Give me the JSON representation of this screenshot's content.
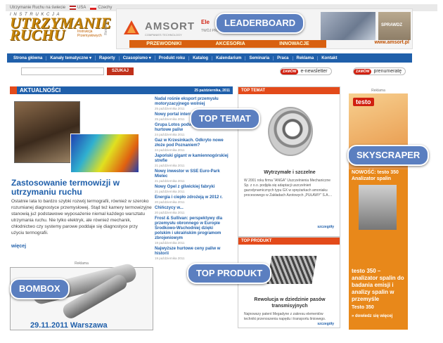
{
  "topbar": {
    "site": "Utrzymanie Ruchu na świecie",
    "usa": "USA",
    "czech": "Czechy"
  },
  "logo": {
    "top": "I N S T R U K C J A",
    "main1": "UTRZYMANIE",
    "main2": "RUCHU",
    "sub": "Instrukcja Przemysłowych",
    "side": "Reklama"
  },
  "leaderboard": {
    "brand": "AMSORT",
    "brand_sub": "COMPANIES TECHNOLOGY",
    "tagline": "Ele",
    "tagline2": "TWÓJ PRZEWODNIK",
    "strip": [
      "PRZEWODNIKI",
      "AKCESORIA",
      "INNOWACJE"
    ],
    "url": "www.amsort.pl",
    "product": "SPRAWDZ"
  },
  "nav": [
    "Strona główna",
    "Kanały tematyczne ▾",
    "Raporty",
    "Czasopismo ▾",
    "Produkt roku",
    "Katalog",
    "Kalendarium",
    "Seminaria",
    "Praca",
    "Reklama",
    "Kontakt"
  ],
  "search": {
    "button": "SZUKAJ"
  },
  "pills": {
    "badge": "ZAMÓW",
    "newsletter": "e-newsletter",
    "prenumerata": "prenumeratę"
  },
  "aktualnosci": {
    "title": "AKTUALNOŚCI",
    "date": "25 października, 2011"
  },
  "main_article": {
    "title": "Zastosowanie termowizji w utrzymaniu ruchu",
    "body": "Ostatnie lata to bardzo szybki rozwój termografii, również w szeroko rozumianej diagnostyce przemysłowej. Stąd też kamery termowizyjne stanowią już podstawowe wyposażenie niemal każdego warsztatu utrzymania ruchu. Nie tylko elektryk, ale również mechanik, chłodnictwo czy systemy parowe poddaje się diagnostyce przy użyciu termografii.",
    "more": "więcej"
  },
  "news": [
    {
      "t": "Nadal rośnie eksport przemysłu motoryzacyjnego wolniej",
      "d": "25 października 2011"
    },
    {
      "t": "Nowy portal internetowy Solid Edge",
      "d": "25 października 2011"
    },
    {
      "t": "Grupa Lotos podwyższyła ceny hurtowe paliw",
      "d": "24 października 2011"
    },
    {
      "t": "Gaz w Krzesinkach. Odkryto nowe złoże pod Poznaniem?",
      "d": "24 października 2011"
    },
    {
      "t": "Japoński gigant w kamiennogórskiej strefie",
      "d": "21 października 2011"
    },
    {
      "t": "Nowy inwestor w SSE Euro-Park Mielec",
      "d": "21 października 2011"
    },
    {
      "t": "Nowy Opel z gliwickiej fabryki",
      "d": "21 października 2011"
    },
    {
      "t": "Energia i ciepło zdrożeją w 2012 r.",
      "d": "20 października 2011"
    },
    {
      "t": "Chińczycy w...",
      "d": "20 października 2011"
    },
    {
      "t": "Frost & Sullivan: perspektywy dla przemysłu obronnego w Europie Środkowo-Wschodniej dzięki polskim i ukraińskim programom zbrojeniowym",
      "d": "19 października 2011"
    },
    {
      "t": "Najwyższe hurtowe ceny paliw w historii",
      "d": "19 października 2011"
    }
  ],
  "top_temat": {
    "header": "TOP TEMAT",
    "title": "Wytrzymałe i szczelne",
    "body": "W 2001 roku firma \"ANGA\" Uszczelnienia Mechaniczne Sp. z o.o. podjęła się adaptacji uszczelnień gazodynamicznych typu GX w sprężarkach amoniaku procesowego w Zakładach Azotowych „PUŁAWY” S.A....",
    "more": "szczegóły"
  },
  "top_produkt": {
    "header": "TOP PRODUKT",
    "title": "Rewolucja w dziedzinie pasów transmisyjnych",
    "body": "Najnowszy patent Megadyne z zakresu elementów techniki przenoszenia napędu i transportu liniowego.",
    "more": "szczegóły"
  },
  "skyscraper": {
    "reklama": "Reklama",
    "logo": "testo",
    "headline": "NOWOŚĆ: testo 350 Analizator spalin",
    "headline2": "testo 350 – analizator spalin do badania emisji i analizy spalin w przemyśle",
    "headline3": "Testo 350",
    "cta": "» dowiedz się więcej"
  },
  "bombox": {
    "reklama": "Reklama",
    "date": "29.11.2011 Warszawa"
  },
  "callouts": {
    "leaderboard": "LEADERBOARD",
    "top_temat": "TOP TEMAT",
    "skyscraper": "SKYSCRAPER",
    "bombox": "BOMBOX",
    "top_produkt": "TOP PRODUKT"
  },
  "colors": {
    "brand_blue": "#1f5faa",
    "accent_red": "#e34a1a",
    "logo_gold": "#c8860a",
    "callout": "#5b7fc0",
    "skyscraper": "#e8881a"
  }
}
